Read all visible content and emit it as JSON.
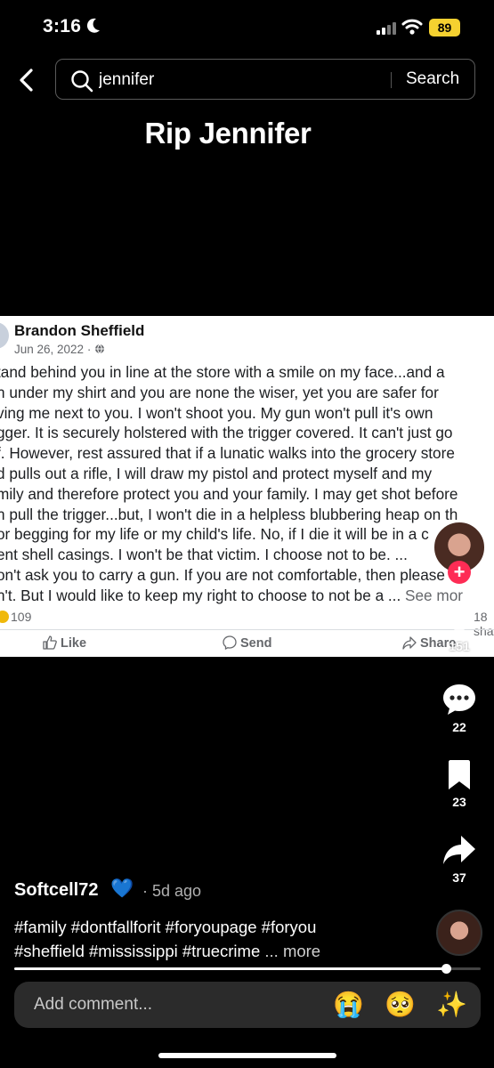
{
  "status_bar": {
    "time": "3:16",
    "battery": "89"
  },
  "search": {
    "query": "jennifer",
    "button_label": "Search"
  },
  "video": {
    "title": "Rip Jennifer",
    "embedded_post": {
      "author": "Brandon Sheffield",
      "date": "Jun 26, 2022 · ",
      "lines": [
        "tand behind you in line at the store with a smile on my face...and a",
        "n under my shirt and you are none the wiser, yet you are safer for",
        "ving me next to you. I won't shoot you. My gun won't pull it's own",
        "gger. It is securely holstered with the trigger covered. It can't just go",
        "f. However, rest assured that if a lunatic walks into the grocery store",
        "d pulls out a rifle, I will draw my pistol and protect myself and my",
        "mily and therefore protect you and your family. I may get shot before",
        "n pull the trigger...but, I won't die in a helpless blubbering heap on th",
        "or begging for my life or my child's life. No, if I die it will be in a c",
        "ent shell casings. I won't be that victim. I choose not to be. ...",
        "on't ask you to carry a gun. If you are not comfortable, then please",
        "n't. But I would like to keep my right to choose to not be a ... "
      ],
      "see_more": "See mor",
      "reaction_count": "109",
      "shares_cut": "18 sha",
      "actions": {
        "like": "Like",
        "send": "Send",
        "share": "Share"
      }
    }
  },
  "side_actions": {
    "likes": "151",
    "comments": "22",
    "bookmarks": "23",
    "shares": "37"
  },
  "creator": {
    "username": "Softcell72",
    "heart_emoji": "💙",
    "posted_ago": "· 5d ago",
    "caption_line1": "#family #dontfallforit #foryoupage #foryou",
    "caption_line2": "#sheffield #mississippi #truecrime ",
    "caption_more": "... more"
  },
  "progress": 0.925,
  "comment": {
    "placeholder": "Add comment...",
    "emojis": [
      "😭",
      "🥺",
      "✨"
    ]
  },
  "colors": {
    "follow": "#fe2c55",
    "battery": "#f5d130",
    "comment_bar": "#2b2b2b"
  },
  "icons": [
    "moon-icon",
    "signal-icon",
    "wifi-icon",
    "back-chevron-icon",
    "search-icon",
    "heart-icon",
    "comment-icon",
    "bookmark-icon",
    "share-icon"
  ]
}
